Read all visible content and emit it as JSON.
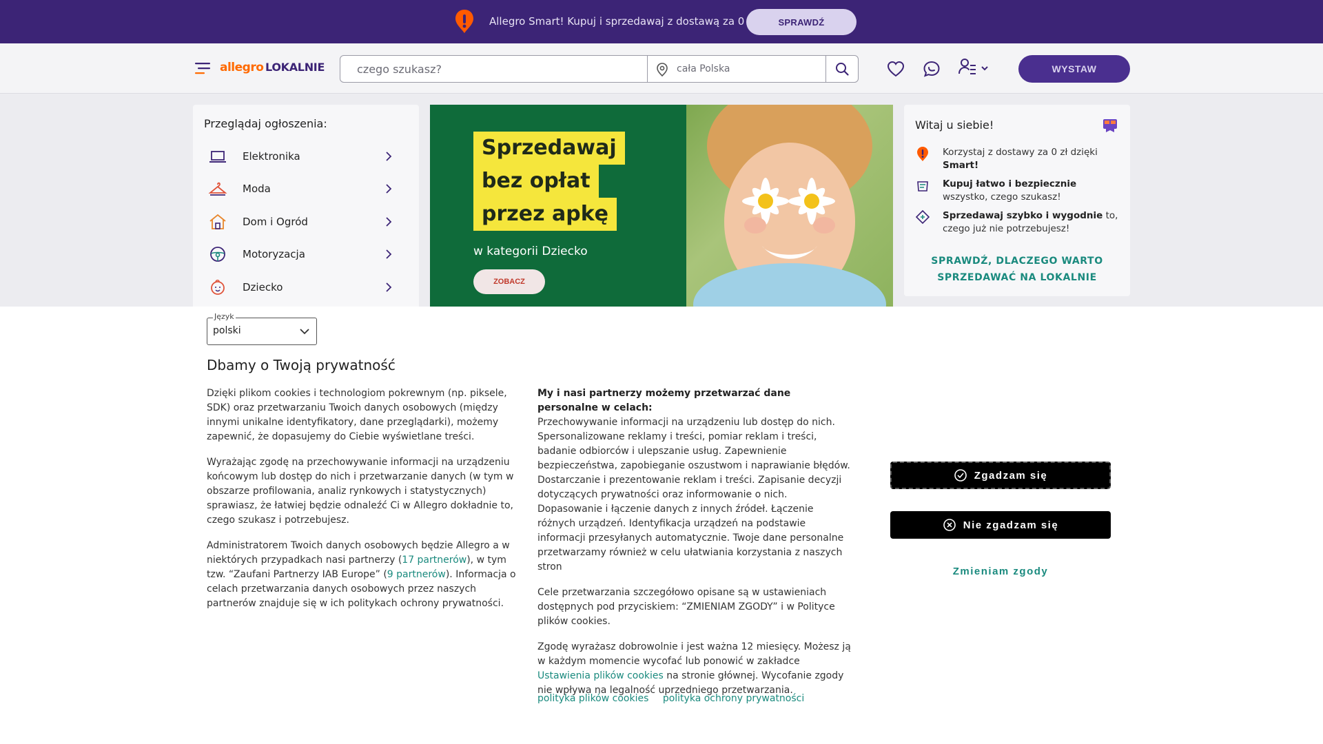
{
  "promo": {
    "text": "Allegro Smart! Kupuj i sprzedawaj z dostawą za 0 zł",
    "button": "SPRAWDŹ"
  },
  "header": {
    "logo_part1": "allegro",
    "logo_part2": "LOKALNIE",
    "search_placeholder": "czego szukasz?",
    "location_placeholder": "cała Polska",
    "sell_button": "WYSTAW"
  },
  "categories": {
    "title": "Przeglądaj ogłoszenia:",
    "items": [
      {
        "label": "Elektronika",
        "icon": "laptop-icon"
      },
      {
        "label": "Moda",
        "icon": "hanger-icon"
      },
      {
        "label": "Dom i Ogród",
        "icon": "house-icon"
      },
      {
        "label": "Motoryzacja",
        "icon": "steering-wheel-icon"
      },
      {
        "label": "Dziecko",
        "icon": "baby-icon"
      }
    ]
  },
  "banner": {
    "line1": "Sprzedawaj",
    "line2": "bez opłat",
    "line3": "przez apkę",
    "subtitle": "w kategorii Dziecko",
    "cta": "ZOBACZ"
  },
  "welcome": {
    "title": "Witaj u siebie!",
    "rows": [
      {
        "pre": "Korzystaj z dostawy za 0 zł dzięki ",
        "bold": "Smart!",
        "post": ""
      },
      {
        "pre": "",
        "bold": "Kupuj łatwo i bezpiecznie",
        "post": " wszystko, czego szukasz!"
      },
      {
        "pre": "",
        "bold": "Sprzedawaj szybko i wygodnie",
        "post": " to, czego już nie potrzebujesz!"
      }
    ],
    "link_line1": "SPRAWDŹ, DLACZEGO WARTO",
    "link_line2": "SPRZEDAWAĆ NA LOKALNIE"
  },
  "cookie": {
    "lang_label": "Język",
    "lang_value": "polski",
    "title": "Dbamy o Twoją prywatność",
    "p1": "Dzięki plikom cookies i technologiom pokrewnym (np. piksele, SDK) oraz przetwarzaniu Twoich danych osobowych (między innymi unikalne identyfikatory, dane przeglądarki), możemy zapewnić, że dopasujemy do Ciebie wyświetlane treści.",
    "p2": "Wyrażając zgodę na przechowywanie informacji na urządzeniu końcowym lub dostęp do nich i przetwarzanie danych (w tym w obszarze profilowania, analiz rynkowych i statystycznych) sprawiasz, że łatwiej będzie odnaleźć Ci w Allegro dokładnie to, czego szukasz i potrzebujesz.",
    "p3_a": "Administratorem Twoich danych osobowych będzie Allegro a w niektórych przypadkach nasi partnerzy (",
    "p3_link1": "17 partnerów",
    "p3_b": "), w tym tzw. “Zaufani Partnerzy IAB Europe” (",
    "p3_link2": "9 partnerów",
    "p3_c": "). Informacja o celach przetwarzania danych osobowych przez naszych partnerów znajduje się w ich politykach ochrony prywatności.",
    "c2_heading": "My i nasi partnerzy możemy przetwarzać dane personalne w celach:",
    "c2_p1": "Przechowywanie informacji na urządzeniu lub dostęp do nich. Spersonalizowane reklamy i treści, pomiar reklam i treści, badanie odbiorców i ulepszanie usług. Zapewnienie bezpieczeństwa, zapobieganie oszustwom i naprawianie błędów. Dostarczanie i prezentowanie reklam i treści. Zapisanie decyzji dotyczących prywatności oraz informowanie o nich. Dopasowanie i łączenie danych z innych źródeł. Łączenie różnych urządzeń. Identyfikacja urządzeń na podstawie informacji przesyłanych automatycznie. Twoje dane personalne przetwarzamy również w celu ułatwiania korzystania z naszych stron",
    "c2_p2": "Cele przetwarzania szczegółowo opisane są w ustawieniach dostępnych pod przyciskiem: “ZMIENIAM ZGODY” i w Polityce plików cookies.",
    "c2_p3_a": "Zgodę wyrażasz dobrowolnie i jest ważna 12 miesięcy. Możesz ją w każdym momencie wycofać lub ponowić w zakładce ",
    "c2_p3_link": "Ustawienia plików cookies",
    "c2_p3_b": " na stronie głównej. Wycofanie zgody nie wpływa na legalność uprzedniego przetwarzania.",
    "policy_cookies": "polityka plików cookies",
    "policy_privacy": "polityka ochrony prywatności",
    "accept": "Zgadzam się",
    "reject": "Nie zgadzam się",
    "change": "Zmieniam zgody"
  },
  "colors": {
    "brand_purple": "#3c2476",
    "brand_orange": "#ff6a00",
    "link_teal": "#1a8a7e"
  }
}
